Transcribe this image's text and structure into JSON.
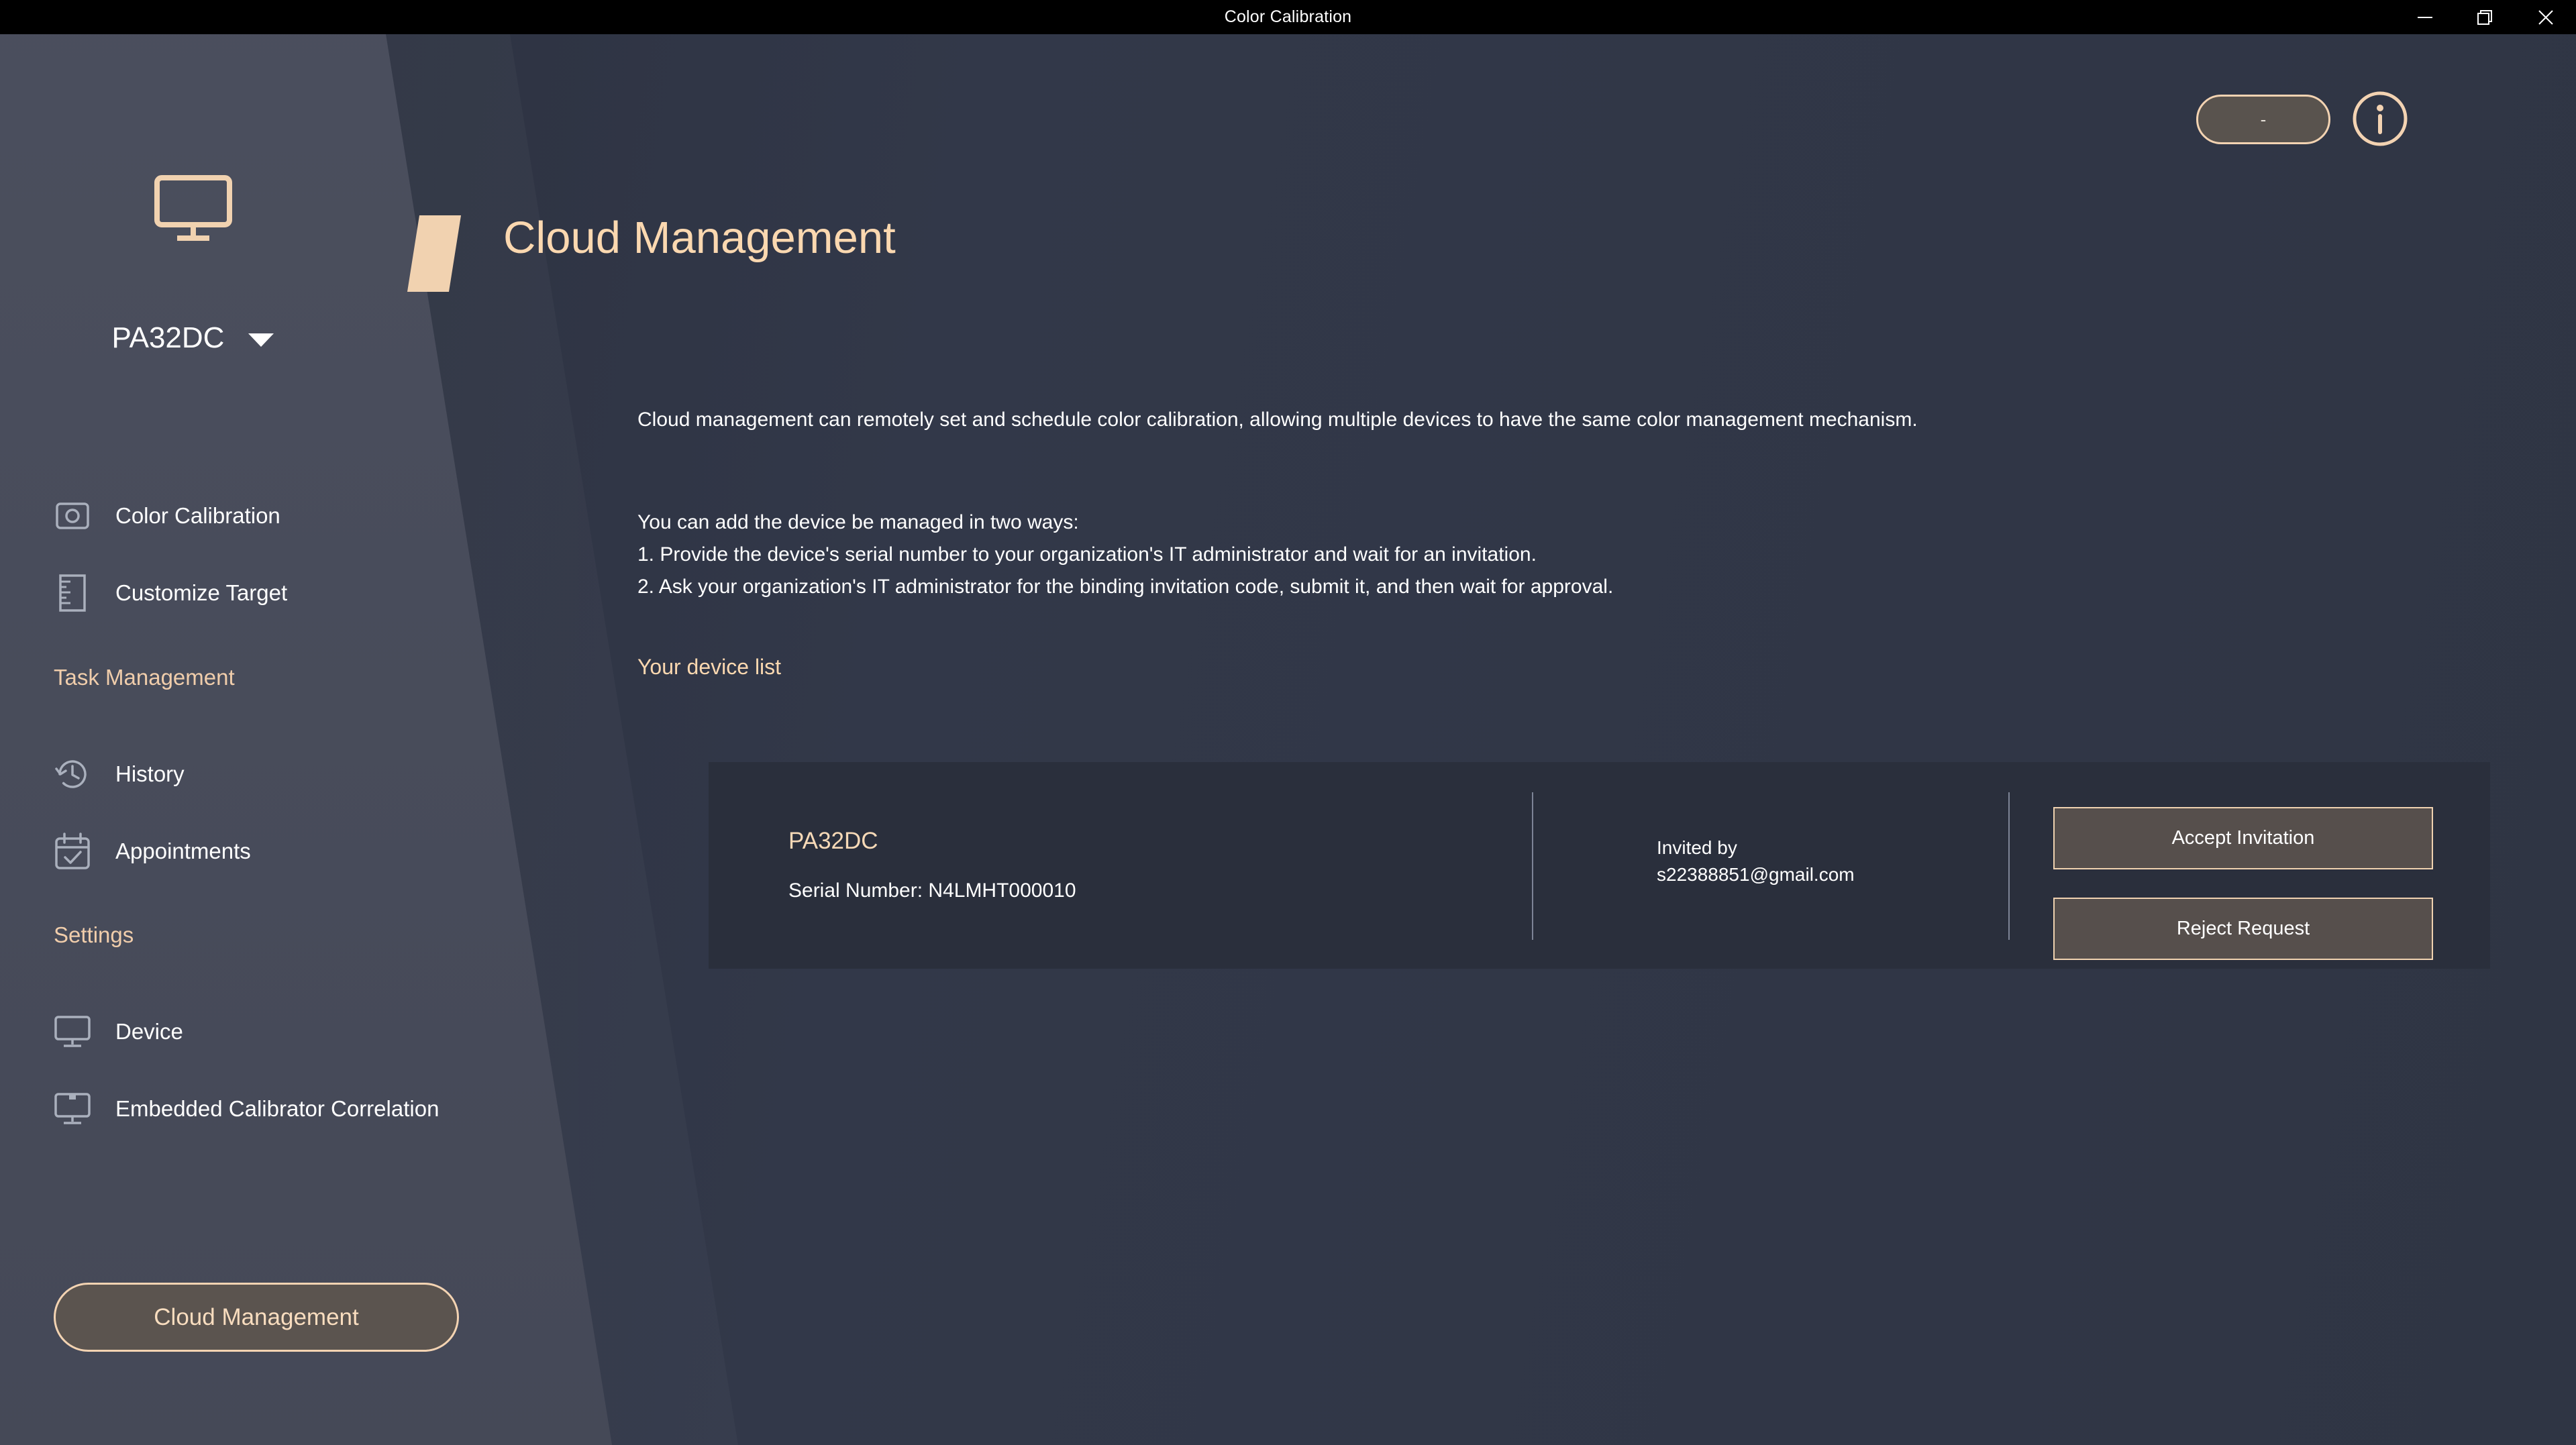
{
  "window": {
    "title": "Color Calibration",
    "controls": [
      {
        "name": "minimize",
        "glyph": "minimize-icon"
      },
      {
        "name": "restore",
        "glyph": "restore-icon"
      },
      {
        "name": "close",
        "glyph": "close-icon"
      }
    ]
  },
  "colors": {
    "accent_tan": "#f1d2b0",
    "title_tan": "#fbd8b0",
    "sidebar_bg": "#474b5a",
    "main_bg": "#2f3544",
    "card_bg": "#2a2f3c",
    "button_fill": "#564f4c",
    "text_white": "#ffffff",
    "titlebar_bg": "#000000"
  },
  "sidebar": {
    "device_icon": "monitor-icon",
    "device_name": "PA32DC",
    "device_caret": "chevron-down-icon",
    "items": [
      {
        "label": "Color Calibration",
        "icon": "aperture-icon"
      },
      {
        "label": "Customize Target",
        "icon": "ruler-icon"
      }
    ],
    "section_task_management": "Task Management",
    "task_items": [
      {
        "label": "History",
        "icon": "history-clock-icon"
      },
      {
        "label": "Appointments",
        "icon": "calendar-check-icon"
      }
    ],
    "section_settings": "Settings",
    "settings_items": [
      {
        "label": "Device",
        "icon": "monitor-icon"
      },
      {
        "label": "Embedded Calibrator Correlation",
        "icon": "monitor-calibrator-icon"
      }
    ],
    "cloud_button": "Cloud Management"
  },
  "topbar": {
    "account_pill_label": "-",
    "info_icon": "info-circle-icon"
  },
  "page": {
    "title": "Cloud Management",
    "intro": "Cloud management can remotely set and schedule color calibration, allowing multiple devices to have the same color management mechanism.",
    "ways_heading": "You can add the device be managed in two ways:",
    "way_1": "1. Provide the device's serial number to your organization's IT administrator and wait for an invitation.",
    "way_2": "2. Ask your organization's IT administrator for the binding invitation code, submit it, and then wait for approval.",
    "device_list_heading": "Your device list"
  },
  "device_card": {
    "name": "PA32DC",
    "serial_label": "Serial Number: N4LMHT000010",
    "invited_by_label": "Invited by",
    "invited_by_email": "s22388851@gmail.com",
    "accept_button": "Accept Invitation",
    "reject_button": "Reject Request"
  }
}
